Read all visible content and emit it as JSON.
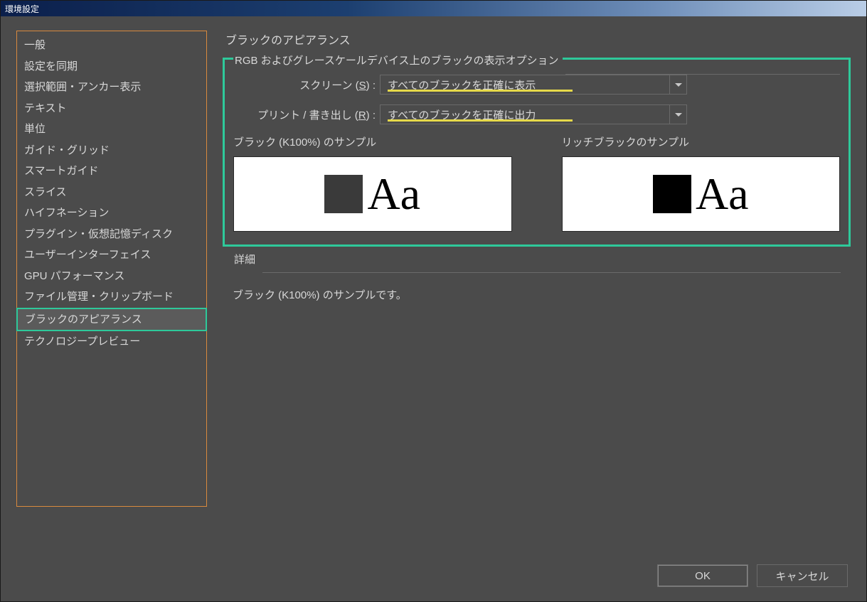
{
  "window": {
    "title": "環境設定"
  },
  "sidebar": {
    "items": [
      "一般",
      "設定を同期",
      "選択範囲・アンカー表示",
      "テキスト",
      "単位",
      "ガイド・グリッド",
      "スマートガイド",
      "スライス",
      "ハイフネーション",
      "プラグイン・仮想記憶ディスク",
      "ユーザーインターフェイス",
      "GPU パフォーマンス",
      "ファイル管理・クリップボード",
      "ブラックのアピアランス",
      "テクノロジープレビュー"
    ],
    "selected_index": 13
  },
  "main": {
    "title": "ブラックのアピアランス",
    "group1": {
      "legend": "RGB およびグレースケールデバイス上のブラックの表示オプション",
      "screen_label_pre": "スクリーン (",
      "screen_label_u": "S",
      "screen_label_post": ") :",
      "screen_value": "すべてのブラックを正確に表示",
      "print_label_pre": "プリント / 書き出し (",
      "print_label_u": "R",
      "print_label_post": ") :",
      "print_value": "すべてのブラックを正確に出力",
      "sample1_label": "ブラック (K100%) のサンプル",
      "sample2_label": "リッチブラックのサンプル",
      "sample_aa": "Aa"
    },
    "group2": {
      "legend": "詳細",
      "text": "ブラック (K100%) のサンプルです。"
    }
  },
  "buttons": {
    "ok": "OK",
    "cancel": "キャンセル"
  }
}
